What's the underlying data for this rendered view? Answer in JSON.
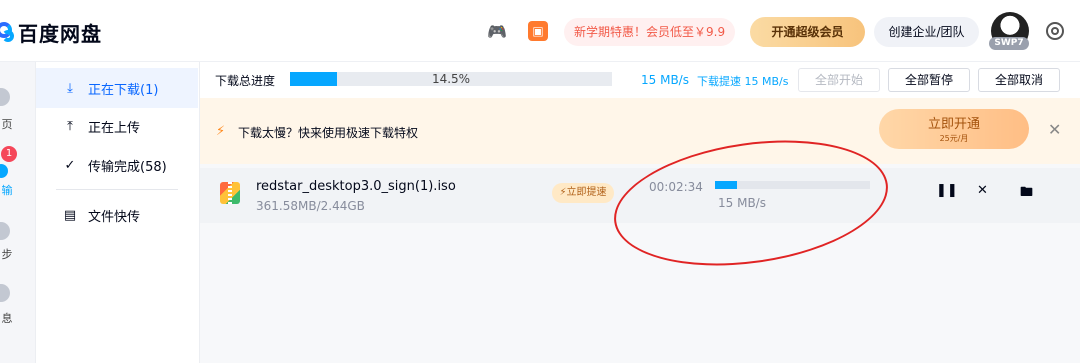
{
  "header": {
    "app_name": "百度网盘",
    "promo": "新学期特惠！会员低至￥9.9",
    "vip_button": "开通超级会员",
    "team_button": "创建企业/团队",
    "avatar_badge": "SWP7"
  },
  "leftbar": {
    "items": [
      "页",
      "输",
      "步",
      "息"
    ],
    "badge": "1"
  },
  "sidenav": {
    "items": [
      {
        "label": "正在下载(1)",
        "icon": "download-icon"
      },
      {
        "label": "正在上传",
        "icon": "upload-icon"
      },
      {
        "label": "传输完成(58)",
        "icon": "check-circle-icon"
      },
      {
        "label": "文件快传",
        "icon": "monitor-icon"
      }
    ]
  },
  "topbar": {
    "label": "下载总进度",
    "progress": 0.145,
    "progress_text": "14.5%",
    "speed": "15 MB/s",
    "boost_text": "下载提速 15 MB/s",
    "start_all": "全部开始",
    "pause_all": "全部暂停",
    "cancel_all": "全部取消"
  },
  "banner": {
    "text": "下载太慢？快来使用极速下载特权",
    "button": "立即开通",
    "button_sub": "25元/月"
  },
  "download": {
    "filename": "redstar_desktop3.0_sign(1).iso",
    "size": "361.58MB/2.44GB",
    "boost_badge": "立即提速",
    "time_left": "00:02:34",
    "progress": 0.145,
    "speed": "15 MB/s"
  }
}
